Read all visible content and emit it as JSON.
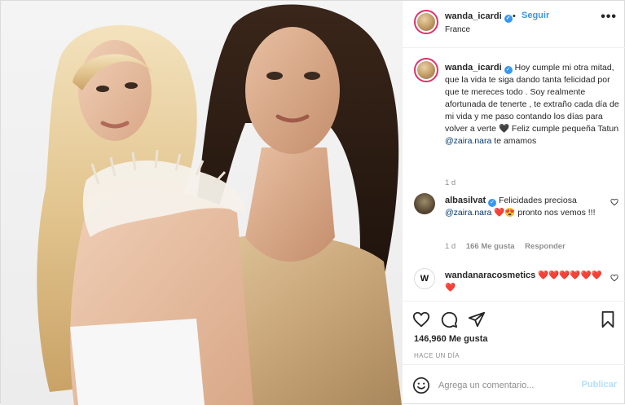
{
  "post": {
    "username": "wanda_icardi",
    "follow_label": "Seguir",
    "separator": "•",
    "location": "France",
    "more_label": "•••"
  },
  "caption": {
    "username": "wanda_icardi",
    "text": "Hoy cumple mi otra mitad, que la vida te siga dando tanta felicidad por que te mereces todo . Soy realmente afortunada de tenerte , te extraño cada día de mi vida y me paso contando los días para volver a verte 🖤 Feliz cumple pequeña Tatun",
    "mention": "@zaira.nara",
    "text_after": " te amamos",
    "time": "1 d"
  },
  "comments": [
    {
      "username": "albasilvat",
      "text": "Felicidades preciosa",
      "mention": "@zaira.nara",
      "emojis": "❤️😍",
      "text_after": " pronto nos vemos !!!",
      "time": "1 d",
      "likes": "166 Me gusta",
      "reply": "Responder"
    },
    {
      "username": "wandanaracosmetics",
      "avatar_letter": "W",
      "emojis": "❤️❤️❤️❤️❤️❤️❤️"
    }
  ],
  "actions": {
    "likes": "146,960 Me gusta",
    "time_ago": "HACE UN DÍA"
  },
  "add_comment": {
    "placeholder": "Agrega un comentario...",
    "publish": "Publicar"
  },
  "colors": {
    "accent_blue": "#3897f0",
    "verified": "#3897f0",
    "mention": "#00376b",
    "publish_disabled": "#b2dffc",
    "heart": "#e0245e"
  },
  "icons": [
    "verified-badge-icon",
    "more-icon",
    "heart-icon",
    "comment-icon",
    "share-icon",
    "bookmark-icon",
    "emoji-icon"
  ]
}
